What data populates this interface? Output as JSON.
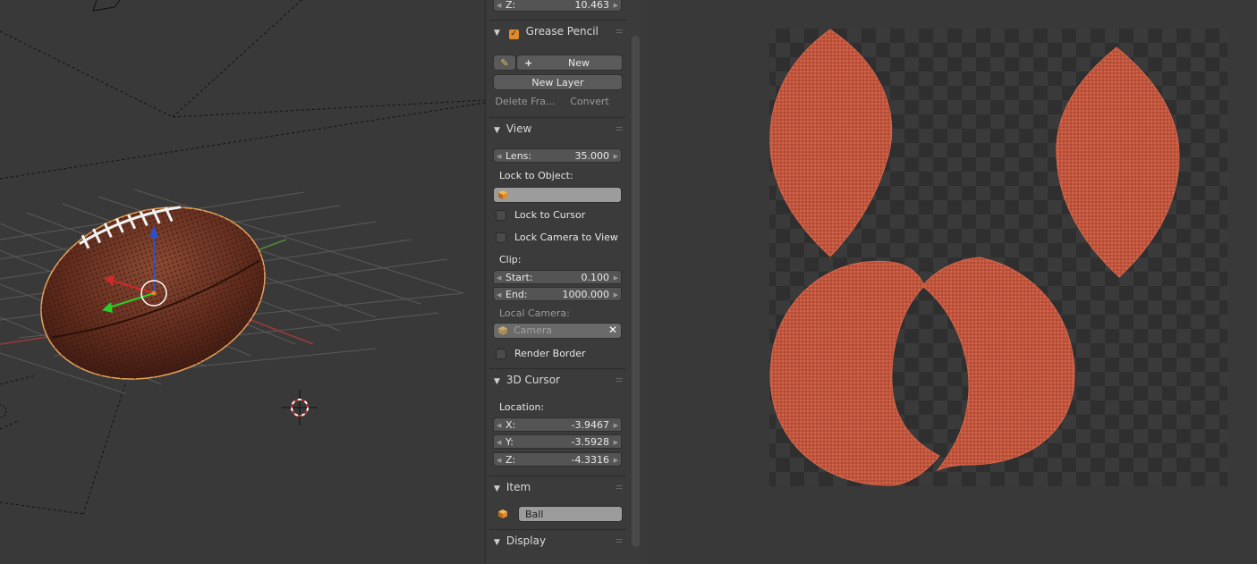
{
  "top_field": {
    "label": "Z:",
    "value": "10.463"
  },
  "grease_pencil": {
    "title": "Grease Pencil",
    "new_label": "New",
    "new_layer_label": "New Layer",
    "delete_frame_label": "Delete Fra...",
    "convert_label": "Convert"
  },
  "view": {
    "title": "View",
    "lens": {
      "label": "Lens:",
      "value": "35.000"
    },
    "lock_to_object_label": "Lock to Object:",
    "lock_to_cursor_label": "Lock to Cursor",
    "lock_camera_label": "Lock Camera to View",
    "clip_label": "Clip:",
    "clip_start": {
      "label": "Start:",
      "value": "0.100"
    },
    "clip_end": {
      "label": "End:",
      "value": "1000.000"
    },
    "local_camera_label": "Local Camera:",
    "local_camera_value": "Camera",
    "render_border_label": "Render Border"
  },
  "cursor": {
    "title": "3D Cursor",
    "location_label": "Location:",
    "x": {
      "label": "X:",
      "value": "-3.9467"
    },
    "y": {
      "label": "Y:",
      "value": "-3.5928"
    },
    "z": {
      "label": "Z:",
      "value": "-4.3316"
    }
  },
  "item": {
    "title": "Item",
    "name": "Ball"
  },
  "display": {
    "title": "Display"
  },
  "icons": {
    "collapse": "triangle-down-icon",
    "grip": "grip-dots-icon",
    "pencil": "pencil-icon",
    "add": "plus-icon",
    "object": "cube-icon",
    "clear": "x-icon"
  },
  "colors": {
    "accent_orange": "#e08a2c",
    "leather": "#b5452e",
    "checker_dark": "#2f2f2f",
    "checker_light": "#3a3a3a"
  }
}
